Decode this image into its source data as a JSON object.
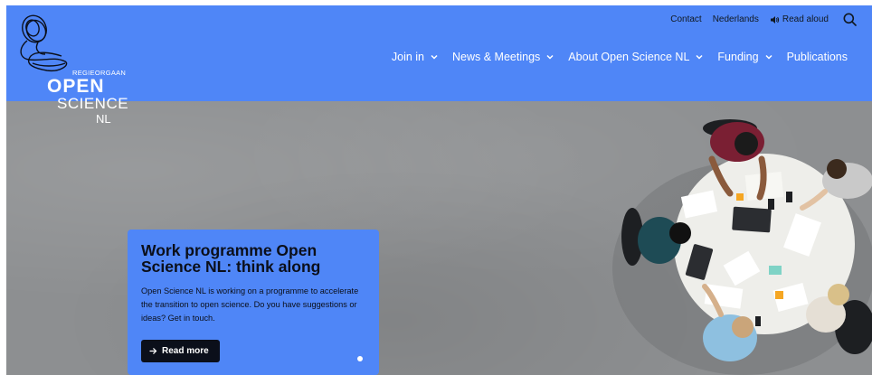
{
  "brand": {
    "logo_icon": "scribble-logo-icon",
    "subtitle": "REGIEORGAAN",
    "name_line1": "OPEN",
    "name_line2": "SCIENCE",
    "name_line3": "NL"
  },
  "utility_nav": {
    "contact": "Contact",
    "language": "Nederlands",
    "read_aloud": "Read aloud",
    "read_aloud_icon": "speaker-icon",
    "search_icon": "search-icon"
  },
  "main_nav": {
    "items": [
      {
        "label": "Join in",
        "has_dropdown": true
      },
      {
        "label": "News & Meetings",
        "has_dropdown": true
      },
      {
        "label": "About Open Science NL",
        "has_dropdown": true
      },
      {
        "label": "Funding",
        "has_dropdown": true
      },
      {
        "label": "Publications",
        "has_dropdown": false
      }
    ]
  },
  "hero": {
    "title": "Work programme Open Science NL: think along",
    "body": "Open Science NL is working on a programme to accelerate the transition to open science. Do you have suggestions or ideas? Get in touch.",
    "button_label": "Read more",
    "button_icon": "arrow-right-icon",
    "image_alt": "students-around-table-photo"
  },
  "colors": {
    "brand_blue": "#4f86f7",
    "dark": "#0b0f1a",
    "concrete": "#8d8f91"
  }
}
